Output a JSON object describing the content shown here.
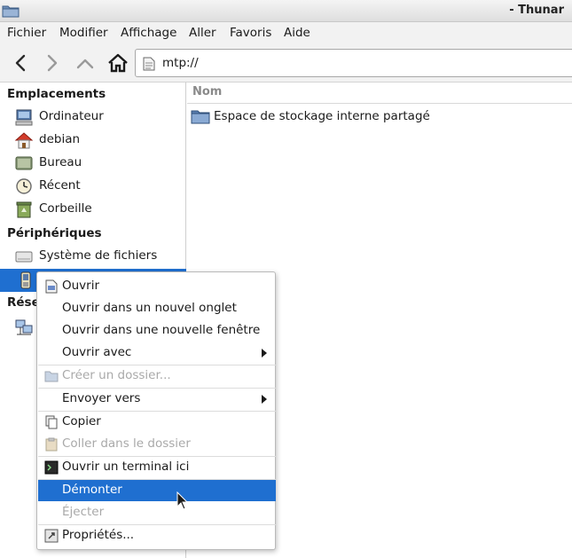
{
  "window": {
    "title": "- Thunar"
  },
  "menubar": {
    "items": [
      "Fichier",
      "Modifier",
      "Affichage",
      "Aller",
      "Favoris",
      "Aide"
    ]
  },
  "toolbar": {
    "back_icon": "back-arrow-icon",
    "forward_icon": "forward-arrow-icon",
    "up_icon": "up-arrow-icon",
    "home_icon": "home-icon",
    "location": "mtp://"
  },
  "sidebar": {
    "sections": [
      {
        "title": "Emplacements",
        "items": [
          "Ordinateur",
          "debian",
          "Bureau",
          "Récent",
          "Corbeille"
        ]
      },
      {
        "title": "Périphériques",
        "items": [
          "Système de fichiers"
        ]
      },
      {
        "title": "Rése"
      }
    ]
  },
  "main": {
    "column_header": "Nom",
    "files": [
      {
        "name": "Espace de stockage interne partagé",
        "icon": "folder-icon"
      }
    ]
  },
  "context_menu": {
    "items": [
      {
        "label": "Ouvrir",
        "icon": "open-document-icon"
      },
      {
        "label": "Ouvrir dans un nouvel onglet"
      },
      {
        "label": "Ouvrir dans une nouvelle fenêtre"
      },
      {
        "label": "Ouvrir avec",
        "submenu": true
      },
      {
        "label": "Créer un dossier...",
        "disabled": true,
        "icon": "folder-new-icon"
      },
      {
        "label": "Envoyer vers",
        "submenu": true
      },
      {
        "label": "Copier",
        "icon": "copy-icon"
      },
      {
        "label": "Coller dans le dossier",
        "disabled": true,
        "icon": "paste-icon"
      },
      {
        "label": "Ouvrir un terminal ici",
        "icon": "terminal-icon"
      },
      {
        "label": "Démonter",
        "highlighted": true
      },
      {
        "label": "Éjecter",
        "disabled": true
      },
      {
        "label": "Propriétés...",
        "icon": "properties-icon"
      }
    ]
  },
  "colors": {
    "selection": "#1f6fd0",
    "disabled_text": "#a9a9a9"
  }
}
